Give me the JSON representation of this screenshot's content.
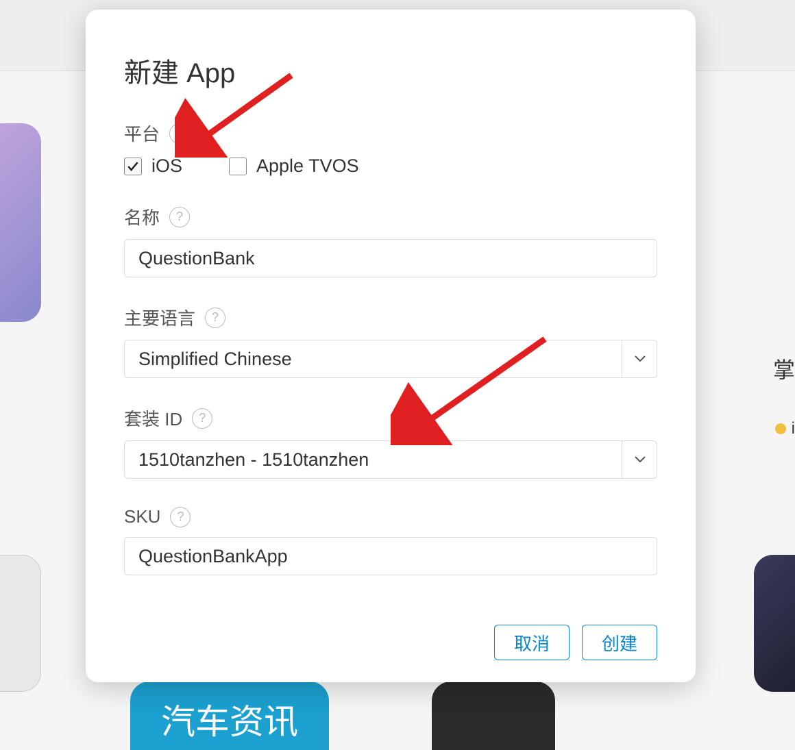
{
  "modal": {
    "title": "新建 App",
    "platform": {
      "label": "平台",
      "options": [
        {
          "label": "iOS",
          "checked": true
        },
        {
          "label": "Apple TVOS",
          "checked": false
        }
      ]
    },
    "name": {
      "label": "名称",
      "value": "QuestionBank"
    },
    "language": {
      "label": "主要语言",
      "value": "Simplified Chinese"
    },
    "bundleId": {
      "label": "套装 ID",
      "value": "1510tanzhen - 1510tanzhen"
    },
    "sku": {
      "label": "SKU",
      "value": "QuestionBankApp"
    },
    "buttons": {
      "cancel": "取消",
      "create": "创建"
    }
  },
  "background": {
    "rightText": "掌",
    "rightStatusChar": "i",
    "bottomApp1": "汽车资讯"
  }
}
